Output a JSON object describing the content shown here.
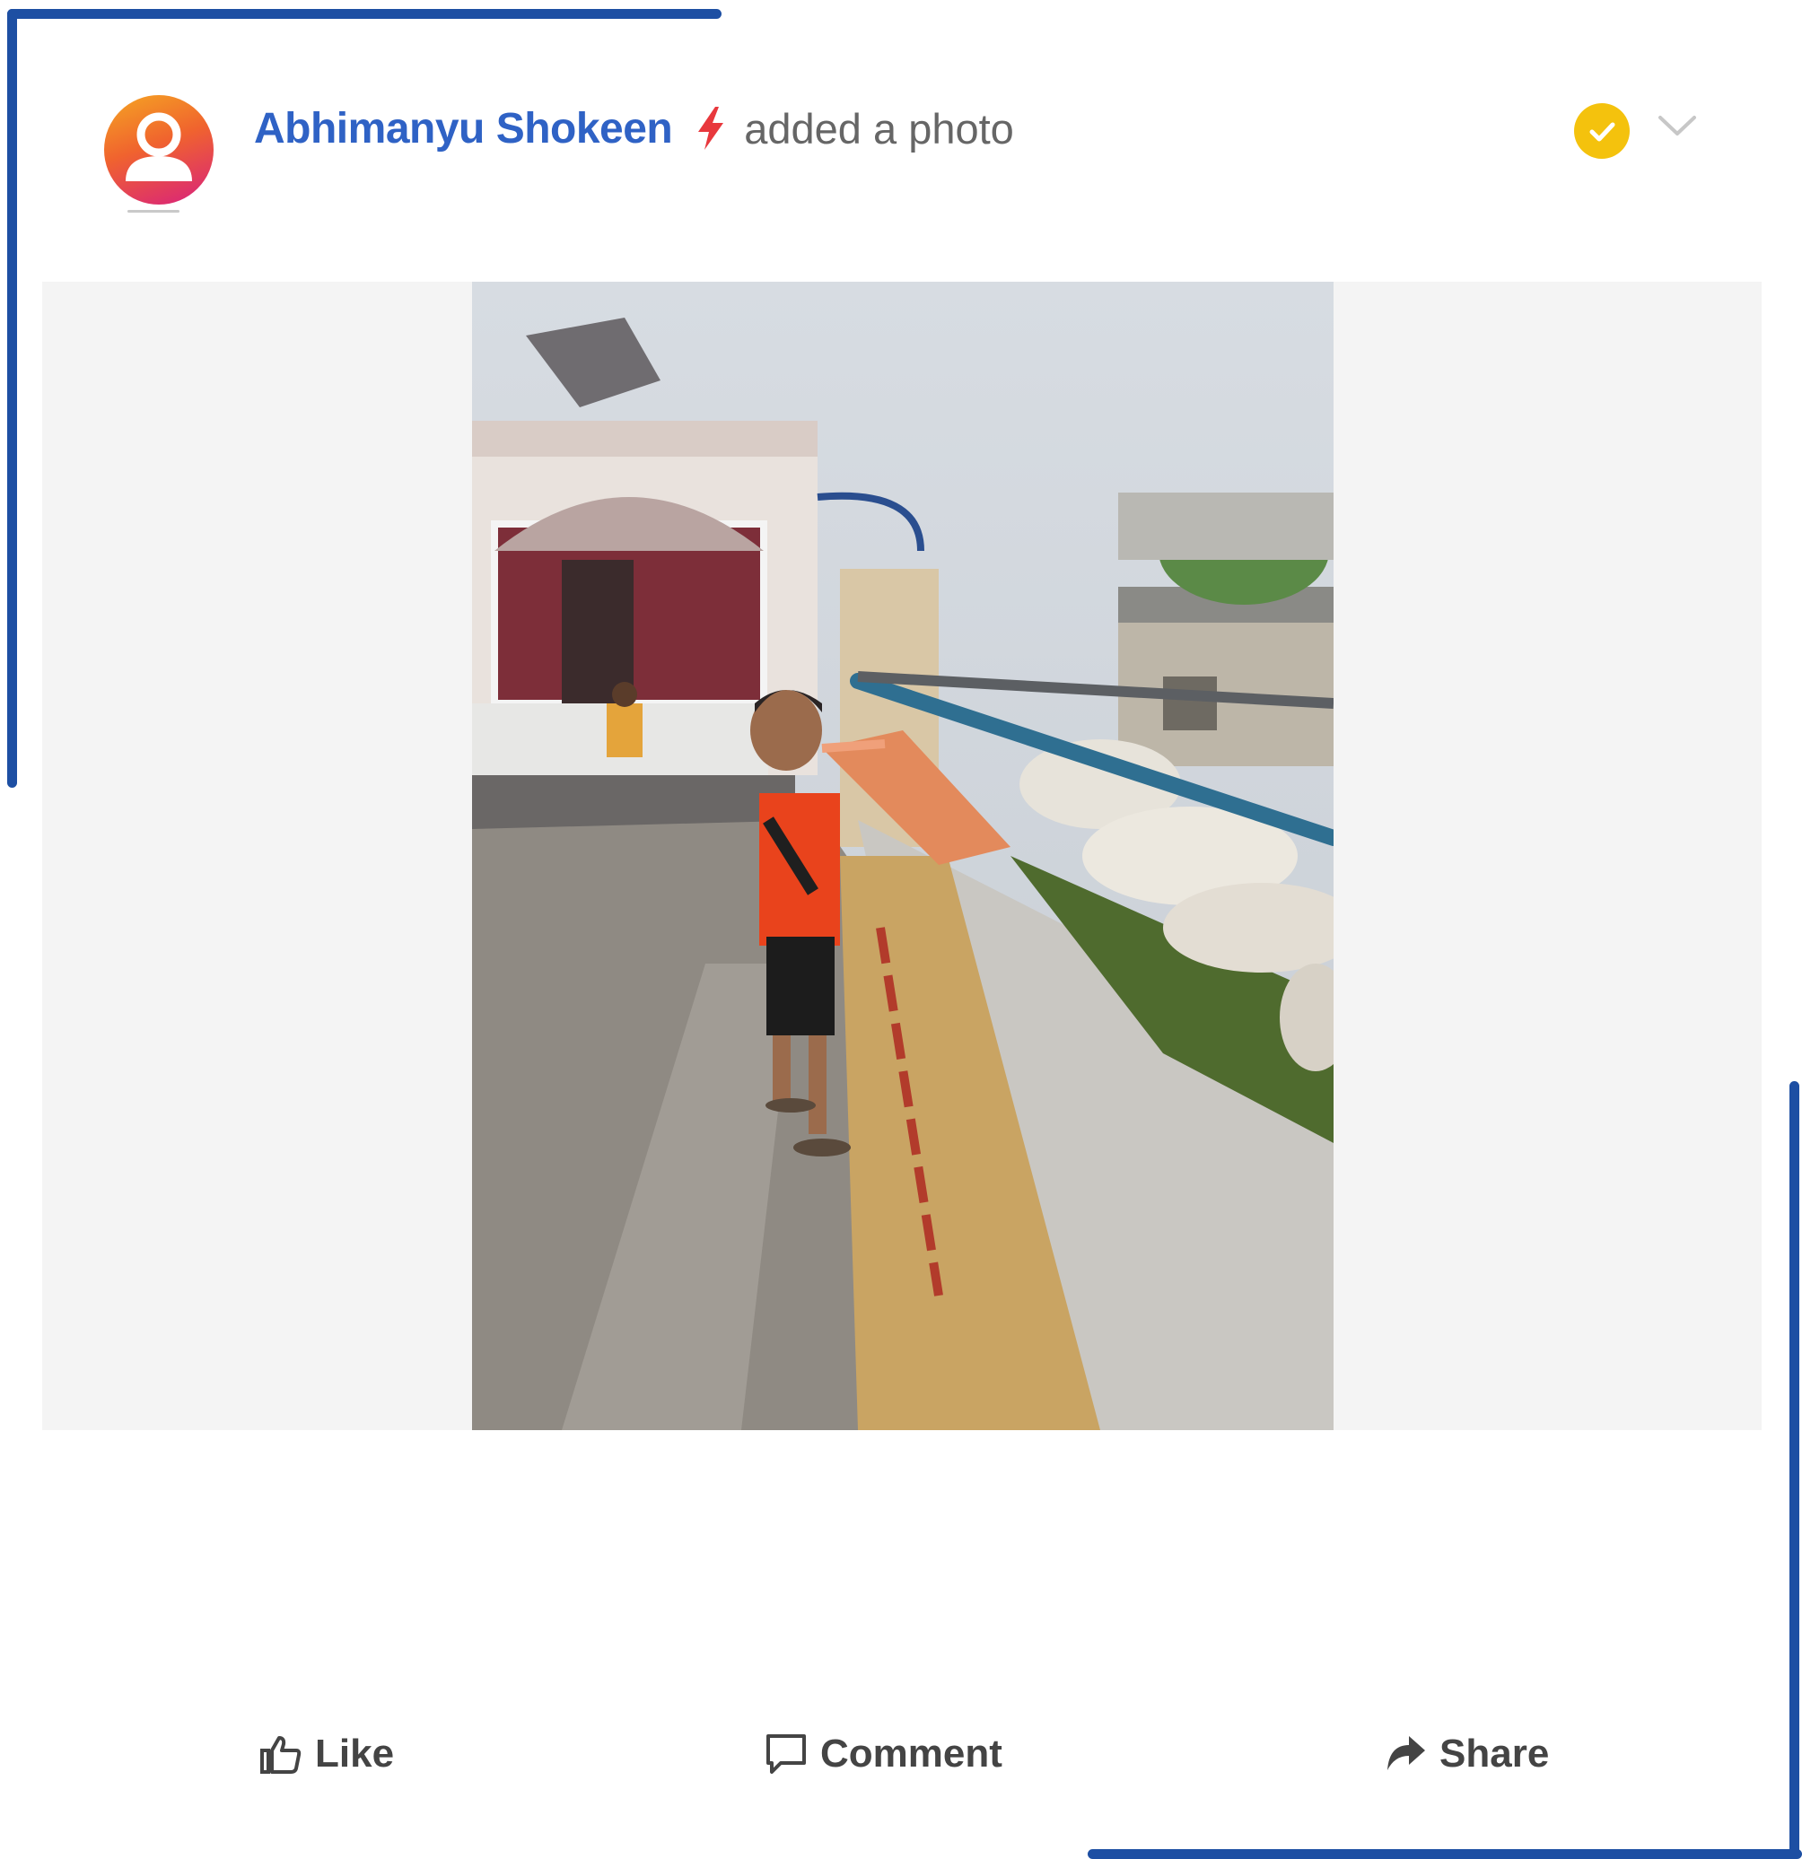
{
  "post": {
    "author": "Abhimanyu Shokeen",
    "action": "added a photo",
    "icons": {
      "avatar": "user-avatar-icon",
      "author_badge": "lightning-bolt-icon",
      "verified": "check-circle-icon",
      "menu": "chevron-down-icon"
    },
    "photo": {
      "alt": "Boy in orange shirt feeding cows at a gaushala wall"
    }
  },
  "actions": {
    "like_label": "Like",
    "comment_label": "Comment",
    "share_label": "Share",
    "icons": [
      "thumbs-up-icon",
      "comment-icon",
      "share-icon"
    ]
  },
  "colors": {
    "frame": "#1d4fa3",
    "author_link": "#2f62c5",
    "bolt": "#e8383d",
    "verified_badge": "#f4c20d",
    "avatar_gradient": [
      "#f5a623",
      "#f0632e",
      "#d8207e"
    ]
  }
}
